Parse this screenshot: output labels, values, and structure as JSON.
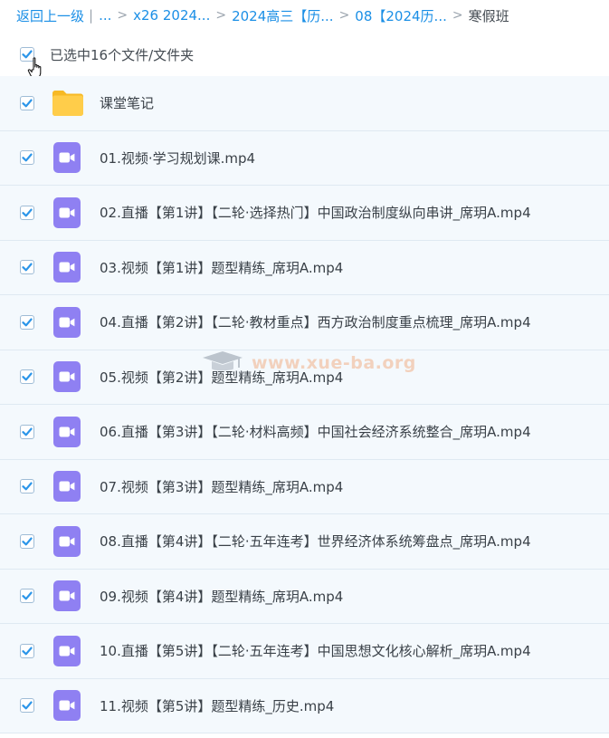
{
  "breadcrumb": {
    "back_label": "返回上一级",
    "ellipsis_label": "...",
    "items": [
      "x26 2024...",
      "2024高三【历...",
      "08【2024历..."
    ],
    "current": "寒假班"
  },
  "selection": {
    "summary": "已选中16个文件/文件夹",
    "checked": true
  },
  "files": [
    {
      "name": "课堂笔记",
      "type": "folder",
      "checked": true
    },
    {
      "name": "01.视频·学习规划课.mp4",
      "type": "video",
      "checked": true
    },
    {
      "name": "02.直播【第1讲】【二轮·选择热门】中国政治制度纵向串讲_席玥A.mp4",
      "type": "video",
      "checked": true
    },
    {
      "name": "03.视频【第1讲】题型精练_席玥A.mp4",
      "type": "video",
      "checked": true
    },
    {
      "name": "04.直播【第2讲】【二轮·教材重点】西方政治制度重点梳理_席玥A.mp4",
      "type": "video",
      "checked": true
    },
    {
      "name": "05.视频【第2讲】题型精练_席玥A.mp4",
      "type": "video",
      "checked": true
    },
    {
      "name": "06.直播【第3讲】【二轮·材料高频】中国社会经济系统整合_席玥A.mp4",
      "type": "video",
      "checked": true
    },
    {
      "name": "07.视频【第3讲】题型精练_席玥A.mp4",
      "type": "video",
      "checked": true
    },
    {
      "name": "08.直播【第4讲】【二轮·五年连考】世界经济体系统筹盘点_席玥A.mp4",
      "type": "video",
      "checked": true
    },
    {
      "name": "09.视频【第4讲】题型精练_席玥A.mp4",
      "type": "video",
      "checked": true
    },
    {
      "name": "10.直播【第5讲】【二轮·五年连考】中国思想文化核心解析_席玥A.mp4",
      "type": "video",
      "checked": true
    },
    {
      "name": "11.视频【第5讲】题型精练_历史.mp4",
      "type": "video",
      "checked": true
    }
  ],
  "watermark": {
    "text": "www.xue-ba.org",
    "icon": "graduation-cap-icon"
  },
  "colors": {
    "link": "#1b8fe6",
    "checkbox": "#2b95e9",
    "video_icon": "#8f80f2",
    "folder_icon": "#ffcb46",
    "row_background": "#f4f9fd"
  }
}
